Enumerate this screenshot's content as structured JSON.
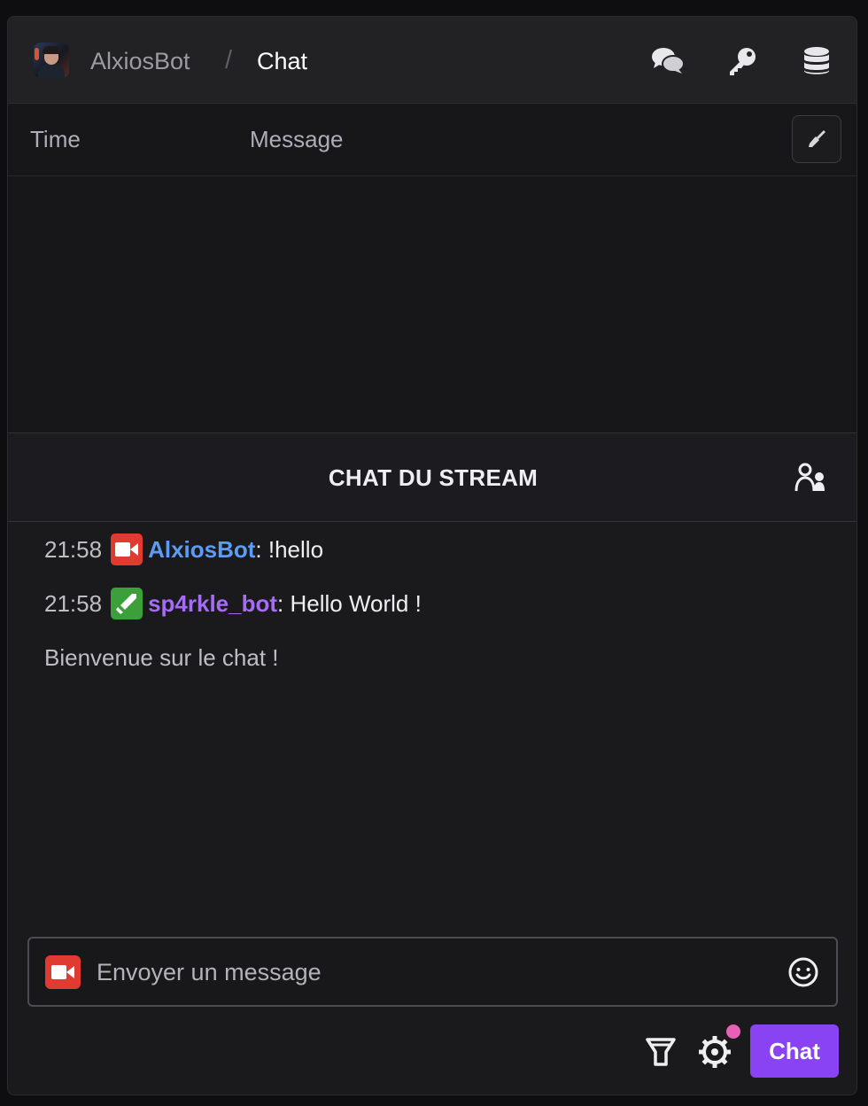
{
  "header": {
    "bot_name": "AlxiosBot",
    "separator": "/",
    "page_title": "Chat",
    "icons": [
      "chat-bubbles-icon",
      "key-icon",
      "database-icon"
    ]
  },
  "log": {
    "columns": [
      "Time",
      "Message"
    ],
    "clear_icon": "broom-icon",
    "rows": []
  },
  "stream_chat": {
    "title": "CHAT DU STREAM",
    "users_icon": "users-icon",
    "messages": [
      {
        "time": "21:58",
        "badge": "broadcaster-badge",
        "username": "AlxiosBot",
        "username_color": "#5c9cf2",
        "separator": ": ",
        "text": "!hello"
      },
      {
        "time": "21:58",
        "badge": "moderator-badge",
        "username": "sp4rkle_bot",
        "username_color": "#a56cf5",
        "separator": ": ",
        "text": "Hello World !"
      }
    ],
    "welcome": "Bienvenue sur le chat !"
  },
  "composer": {
    "placeholder": "Envoyer un message",
    "value": "",
    "send_label": "Chat",
    "accent": "#8a43f2",
    "notification_dot_color": "#e85fb6"
  }
}
